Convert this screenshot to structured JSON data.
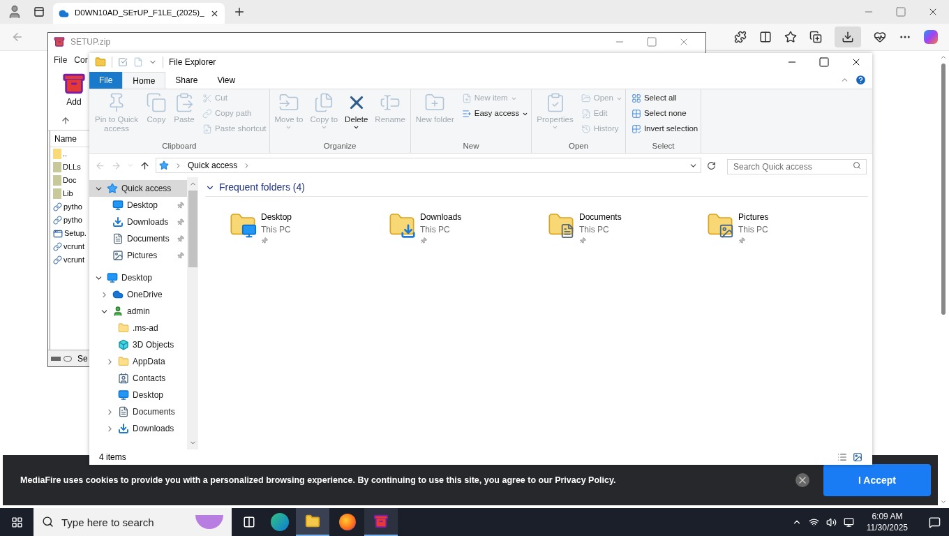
{
  "browser": {
    "tab": {
      "title": "D0WN10AD_SEтUP_F1LE_(2025)_"
    },
    "cookie_banner": {
      "text": "MediaFire uses cookies to provide you with a personalized browsing experience. By continuing to use this site, you agree to our Privacy Policy.",
      "accept_button": "I Accept"
    }
  },
  "winrar": {
    "title": "SETUP.zip",
    "menu": [
      "File",
      "Cor"
    ],
    "toolbar": [
      "Add"
    ],
    "column": "Name",
    "files": [
      {
        "name": "..",
        "kind": "up"
      },
      {
        "name": "DLLs",
        "kind": "folder"
      },
      {
        "name": "Doc",
        "kind": "folder"
      },
      {
        "name": "Lib",
        "kind": "folder"
      },
      {
        "name": "pytho",
        "kind": "file"
      },
      {
        "name": "pytho",
        "kind": "file"
      },
      {
        "name": "Setup.",
        "kind": "app"
      },
      {
        "name": "vcrunt",
        "kind": "file"
      },
      {
        "name": "vcrunt",
        "kind": "file"
      }
    ],
    "status": "Se"
  },
  "explorer": {
    "title": "File Explorer",
    "tabs": [
      {
        "label": "File",
        "kind": "file",
        "selected": false
      },
      {
        "label": "Home",
        "kind": "tab",
        "selected": true
      },
      {
        "label": "Share",
        "kind": "tab",
        "selected": false
      },
      {
        "label": "View",
        "kind": "tab",
        "selected": false
      }
    ],
    "ribbon": [
      {
        "label": "Clipboard",
        "items": [
          {
            "label": "Pin to Quick access",
            "kind": "large",
            "disabled": true,
            "dropdown": false
          },
          {
            "label": "Copy",
            "kind": "large",
            "disabled": true,
            "dropdown": false
          },
          {
            "label": "Paste",
            "kind": "large",
            "disabled": true,
            "dropdown": false
          },
          {
            "label": "Cut",
            "kind": "small",
            "disabled": true,
            "dropdown": false
          },
          {
            "label": "Copy path",
            "kind": "small",
            "disabled": true,
            "dropdown": false
          },
          {
            "label": "Paste shortcut",
            "kind": "small",
            "disabled": true,
            "dropdown": false
          }
        ]
      },
      {
        "label": "Organize",
        "items": [
          {
            "label": "Move to",
            "kind": "large",
            "disabled": true,
            "dropdown": true
          },
          {
            "label": "Copy to",
            "kind": "large",
            "disabled": true,
            "dropdown": true
          },
          {
            "label": "Delete",
            "kind": "large",
            "disabled": false,
            "dropdown": true
          },
          {
            "label": "Rename",
            "kind": "large",
            "disabled": true,
            "dropdown": false
          }
        ]
      },
      {
        "label": "New",
        "items": [
          {
            "label": "New folder",
            "kind": "large",
            "disabled": true,
            "dropdown": false
          },
          {
            "label": "New item",
            "kind": "small",
            "disabled": true,
            "dropdown": true
          },
          {
            "label": "Easy access",
            "kind": "small",
            "disabled": false,
            "dropdown": true
          }
        ]
      },
      {
        "label": "Open",
        "items": [
          {
            "label": "Properties",
            "kind": "large",
            "disabled": true,
            "dropdown": true
          },
          {
            "label": "Open",
            "kind": "small",
            "disabled": true,
            "dropdown": true
          },
          {
            "label": "Edit",
            "kind": "small",
            "disabled": true,
            "dropdown": false
          },
          {
            "label": "History",
            "kind": "small",
            "disabled": true,
            "dropdown": false
          }
        ]
      },
      {
        "label": "Select",
        "items": [
          {
            "label": "Select all",
            "kind": "small",
            "disabled": false,
            "dropdown": false
          },
          {
            "label": "Select none",
            "kind": "small",
            "disabled": false,
            "dropdown": false
          },
          {
            "label": "Invert selection",
            "kind": "small",
            "disabled": false,
            "dropdown": false
          }
        ]
      }
    ],
    "address": {
      "path": [
        "Quick access"
      ],
      "search_placeholder": "Search Quick access"
    },
    "tree": [
      {
        "label": "Quick access",
        "kind": "quick",
        "expanded": true,
        "selected": true,
        "children": [
          {
            "label": "Desktop",
            "kind": "desktop",
            "pinned": true,
            "selected": false
          },
          {
            "label": "Downloads",
            "kind": "downloads",
            "pinned": true,
            "selected": false
          },
          {
            "label": "Documents",
            "kind": "documents",
            "pinned": true,
            "selected": false
          },
          {
            "label": "Pictures",
            "kind": "pictures",
            "pinned": true,
            "selected": false
          }
        ]
      },
      {
        "label": "Desktop",
        "kind": "desktop",
        "expanded": true,
        "selected": false,
        "children": [
          {
            "label": "OneDrive",
            "kind": "onedrive",
            "expanded": false,
            "selected": false
          },
          {
            "label": "admin",
            "kind": "user",
            "expanded": true,
            "selected": false,
            "children": [
              {
                "label": ".ms-ad",
                "kind": "folder",
                "selected": false
              },
              {
                "label": "3D Objects",
                "kind": "cube",
                "selected": false
              },
              {
                "label": "AppData",
                "kind": "folder",
                "expanded": false,
                "selected": false
              },
              {
                "label": "Contacts",
                "kind": "contacts",
                "selected": false
              },
              {
                "label": "Desktop",
                "kind": "desktop",
                "selected": false
              },
              {
                "label": "Documents",
                "kind": "documents",
                "expanded": false,
                "selected": false
              },
              {
                "label": "Downloads",
                "kind": "downloads",
                "expanded": false,
                "selected": false
              }
            ]
          }
        ]
      }
    ],
    "section": {
      "title": "Frequent folders (4)",
      "expanded": true
    },
    "folders": [
      {
        "name": "Desktop",
        "location": "This PC",
        "kind": "desktop",
        "pinned": true
      },
      {
        "name": "Downloads",
        "location": "This PC",
        "kind": "downloads",
        "pinned": true
      },
      {
        "name": "Documents",
        "location": "This PC",
        "kind": "documents",
        "pinned": true
      },
      {
        "name": "Pictures",
        "location": "This PC",
        "kind": "pictures",
        "pinned": true
      }
    ],
    "status": "4 items"
  },
  "taskbar": {
    "search_placeholder": "Type here to search",
    "time": "6:09 AM",
    "date": "11/30/2025"
  }
}
